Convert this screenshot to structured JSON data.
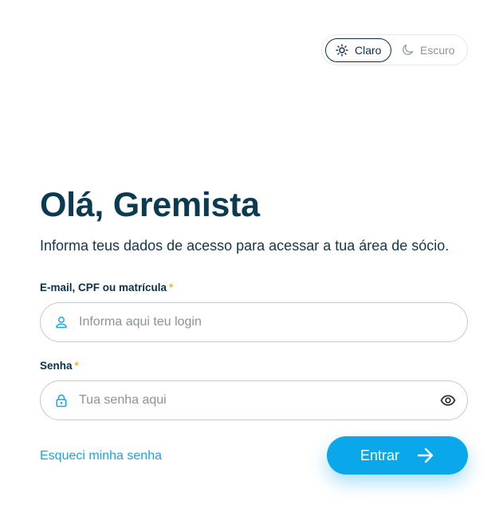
{
  "theme_toggle": {
    "light_label": "Claro",
    "dark_label": "Escuro",
    "selected": "light"
  },
  "heading": {
    "title": "Olá, Gremista",
    "subtitle": "Informa teus dados de acesso para acessar a tua área de sócio."
  },
  "form": {
    "login": {
      "label": "E-mail, CPF ou matrícula",
      "required_mark": "*",
      "placeholder": "Informa aqui teu login",
      "value": "",
      "icon": "user-icon"
    },
    "password": {
      "label": "Senha",
      "required_mark": "*",
      "placeholder": "Tua senha aqui",
      "value": "",
      "icon": "lock-icon",
      "toggle_icon": "eye-icon"
    },
    "forgot_link": "Esqueci minha senha",
    "submit_label": "Entrar"
  },
  "colors": {
    "primary": "#0aa7ea",
    "heading": "#0c3b51",
    "required": "#f4b322",
    "link": "#1aa6e0"
  }
}
